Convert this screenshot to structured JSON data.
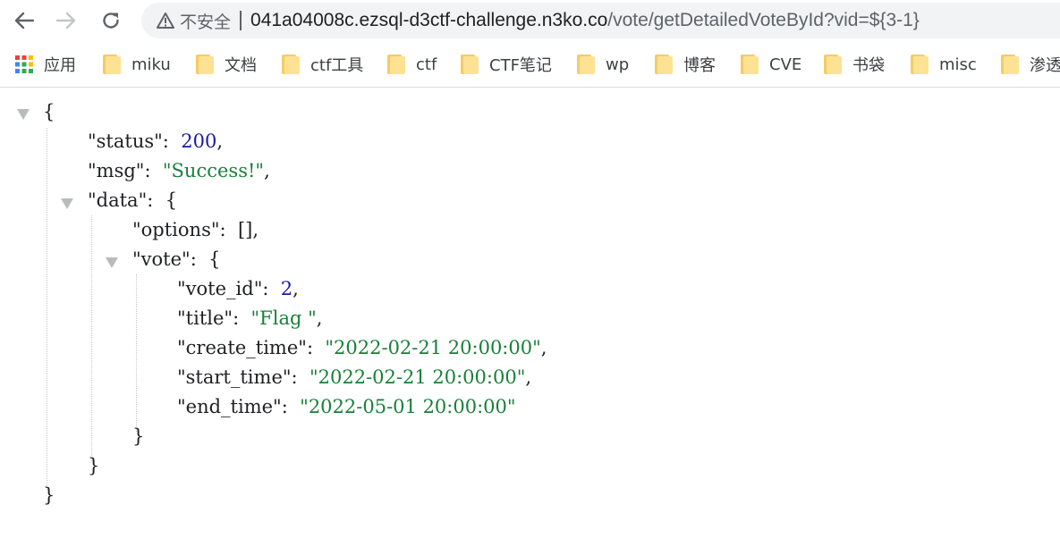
{
  "address_bar": {
    "security_label": "不安全",
    "url_host": "041a04008c.ezsql-d3ctf-challenge.n3ko.co",
    "url_path": "/vote/getDetailedVoteById?vid=${3-1}"
  },
  "bookmarks": [
    {
      "label": "应用",
      "icon": "apps-grid-icon"
    },
    {
      "label": "miku",
      "icon": "folder-icon"
    },
    {
      "label": "文档",
      "icon": "folder-icon"
    },
    {
      "label": "ctf工具",
      "icon": "folder-icon"
    },
    {
      "label": "ctf",
      "icon": "folder-icon"
    },
    {
      "label": "CTF笔记",
      "icon": "folder-icon"
    },
    {
      "label": "wp",
      "icon": "folder-icon"
    },
    {
      "label": "博客",
      "icon": "folder-icon"
    },
    {
      "label": "CVE",
      "icon": "folder-icon"
    },
    {
      "label": "书袋",
      "icon": "folder-icon"
    },
    {
      "label": "misc",
      "icon": "folder-icon"
    },
    {
      "label": "渗透",
      "icon": "folder-icon"
    }
  ],
  "json_view": {
    "status_key": "\"status\"",
    "status_value": "200",
    "msg_key": "\"msg\"",
    "msg_value": "\"Success!\"",
    "data_key": "\"data\"",
    "options_key": "\"options\"",
    "options_value": "[]",
    "vote_key": "\"vote\"",
    "vote_id_key": "\"vote_id\"",
    "vote_id_value": "2",
    "title_key": "\"title\"",
    "title_value": "\"Flag \"",
    "create_time_key": "\"create_time\"",
    "create_time_value": "\"2022-02-21 20:00:00\"",
    "start_time_key": "\"start_time\"",
    "start_time_value": "\"2022-02-21 20:00:00\"",
    "end_time_key": "\"end_time\"",
    "end_time_value": "\"2022-05-01 20:00:00\"",
    "open_brace": "{",
    "close_brace": "}",
    "colon": ":",
    "comma": ","
  },
  "colors": {
    "number": "#1a1aa6",
    "string": "#188038",
    "folder": "#f6cb61"
  }
}
